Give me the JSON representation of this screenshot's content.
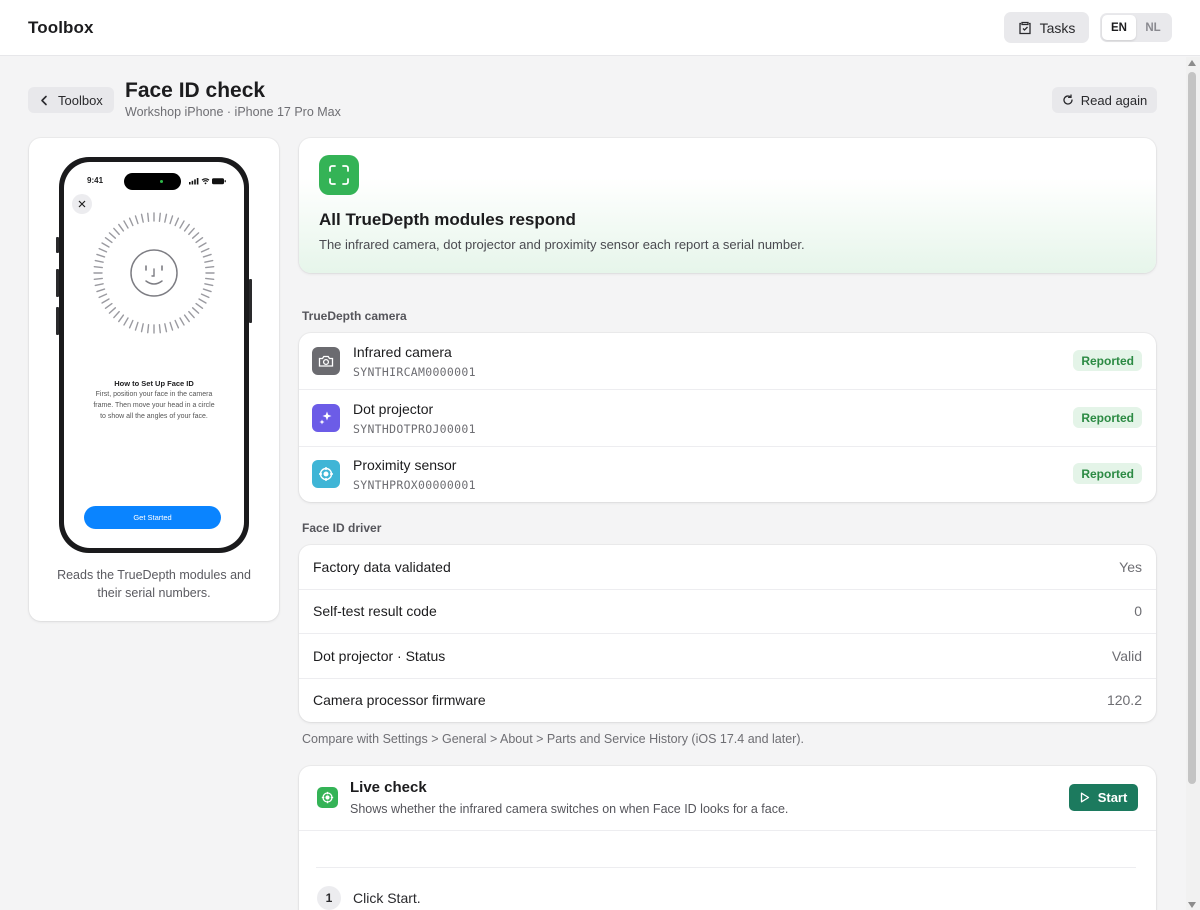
{
  "app": {
    "title": "Toolbox"
  },
  "header": {
    "tasks_label": "Tasks",
    "languages": [
      {
        "code": "EN",
        "active": true
      },
      {
        "code": "NL",
        "active": false
      }
    ]
  },
  "page": {
    "back_label": "Toolbox",
    "title": "Face ID check",
    "subtitle": "Workshop iPhone · iPhone 17 Pro Max",
    "read_again_label": "Read again"
  },
  "phone_preview": {
    "time": "9:41",
    "title": "How to Set Up Face ID",
    "body": "First, position your face in the camera frame. Then move your head in a circle to show all the angles of your face.",
    "cta": "Get Started",
    "caption": "Reads the TrueDepth modules and their serial numbers."
  },
  "result": {
    "title": "All TrueDepth modules respond",
    "text": "The infrared camera, dot projector and proximity sensor each report a serial number.",
    "accent": "#34b356"
  },
  "truedepth": {
    "section_label": "TrueDepth camera",
    "modules": [
      {
        "name": "Infrared camera",
        "serial": "SYNTHIRCAM0000001",
        "status": "Reported",
        "icon": "camera-icon",
        "color": "#6b6b70"
      },
      {
        "name": "Dot projector",
        "serial": "SYNTHDOTPROJ00001",
        "status": "Reported",
        "icon": "sparkles-icon",
        "color": "#6c5ce7"
      },
      {
        "name": "Proximity sensor",
        "serial": "SYNTHPROX00000001",
        "status": "Reported",
        "icon": "target-icon",
        "color": "#3fb5d6"
      }
    ]
  },
  "driver": {
    "section_label": "Face ID driver",
    "rows": [
      {
        "label": "Factory data validated",
        "value": "Yes"
      },
      {
        "label": "Self-test result code",
        "value": "0"
      },
      {
        "label": "Dot projector · Status",
        "value": "Valid"
      },
      {
        "label": "Camera processor firmware",
        "value": "120.2"
      }
    ],
    "note": "Compare with Settings > General > About > Parts and Service History (iOS 17.4 and later)."
  },
  "live_check": {
    "title": "Live check",
    "subtitle": "Shows whether the infrared camera switches on when Face ID looks for a face.",
    "start_label": "Start",
    "steps": [
      {
        "number": "1",
        "text": "Click Start."
      }
    ]
  }
}
